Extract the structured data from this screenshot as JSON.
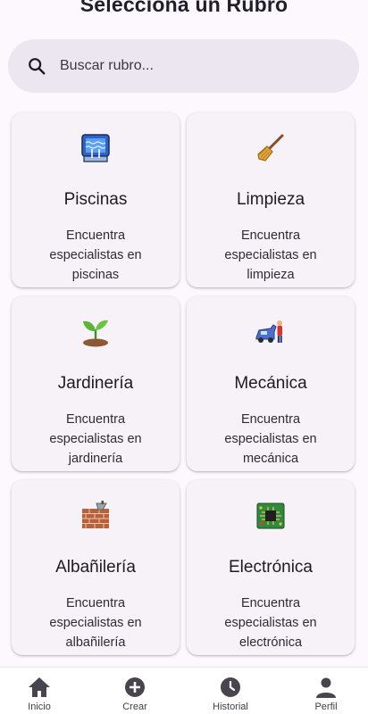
{
  "page": {
    "title": "Selecciona un Rubro"
  },
  "search": {
    "placeholder": "Buscar rubro...",
    "icon": "search-icon"
  },
  "categories": [
    {
      "name": "Piscinas",
      "description": "Encuentra especialistas en piscinas",
      "icon": "pool-icon"
    },
    {
      "name": "Limpieza",
      "description": "Encuentra especialistas en limpieza",
      "icon": "broom-icon"
    },
    {
      "name": "Jardinería",
      "description": "Encuentra especialistas en jardinería",
      "icon": "seedling-icon"
    },
    {
      "name": "Mecánica",
      "description": "Encuentra especialistas en mecánica",
      "icon": "car-mechanic-icon"
    },
    {
      "name": "Albañilería",
      "description": "Encuentra especialistas en albañilería",
      "icon": "brick-wall-icon"
    },
    {
      "name": "Electrónica",
      "description": "Encuentra especialistas en electrónica",
      "icon": "circuit-board-icon"
    }
  ],
  "bottom_nav": [
    {
      "label": "Inicio",
      "icon": "home-icon"
    },
    {
      "label": "Crear",
      "icon": "add-circle-icon"
    },
    {
      "label": "Historial",
      "icon": "clock-icon"
    },
    {
      "label": "Perfil",
      "icon": "person-icon"
    }
  ],
  "colors": {
    "background": "#fdf8fd",
    "card": "#f7f1f8",
    "search_bg": "#ece6f0",
    "nav_icon": "#49454f"
  }
}
